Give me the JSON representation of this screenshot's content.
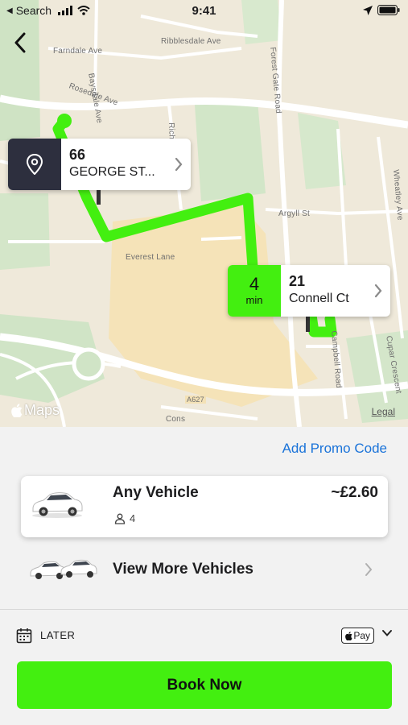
{
  "status_bar": {
    "back_app": "Search",
    "time": "9:41"
  },
  "map": {
    "street_labels": {
      "farndale": "Farndale Ave",
      "ribblesdale": "Ribblesdale Ave",
      "baysdale": "Baysdale Ave",
      "rosedale": "Rosedale Ave",
      "forest_gate": "Forest Gate Road",
      "argyll": "Argyll St",
      "wheatley": "Wheatley Ave",
      "everest": "Everest Lane",
      "campbell": "Campbell Road",
      "cupar": "Cupar Crescent",
      "a627": "A627",
      "cons": "Cons",
      "rich": "Rich"
    },
    "pickup": {
      "number": "66",
      "street": "GEORGE ST..."
    },
    "dropoff": {
      "eta_value": "4",
      "eta_unit": "min",
      "number": "21",
      "street": "Connell Ct"
    },
    "attribution": "Maps",
    "legal": "Legal",
    "colors": {
      "route": "#43ef10",
      "pickup_box": "#2d2f3e"
    }
  },
  "booking": {
    "promo_label": "Add Promo Code",
    "vehicle": {
      "name": "Any Vehicle",
      "price": "~£2.60",
      "seats": "4"
    },
    "more_vehicles_label": "View More Vehicles",
    "schedule_label": "LATER",
    "payment_label": "Pay",
    "book_button_label": "Book Now",
    "colors": {
      "accent": "#43ef10",
      "link": "#1a73d9"
    }
  }
}
